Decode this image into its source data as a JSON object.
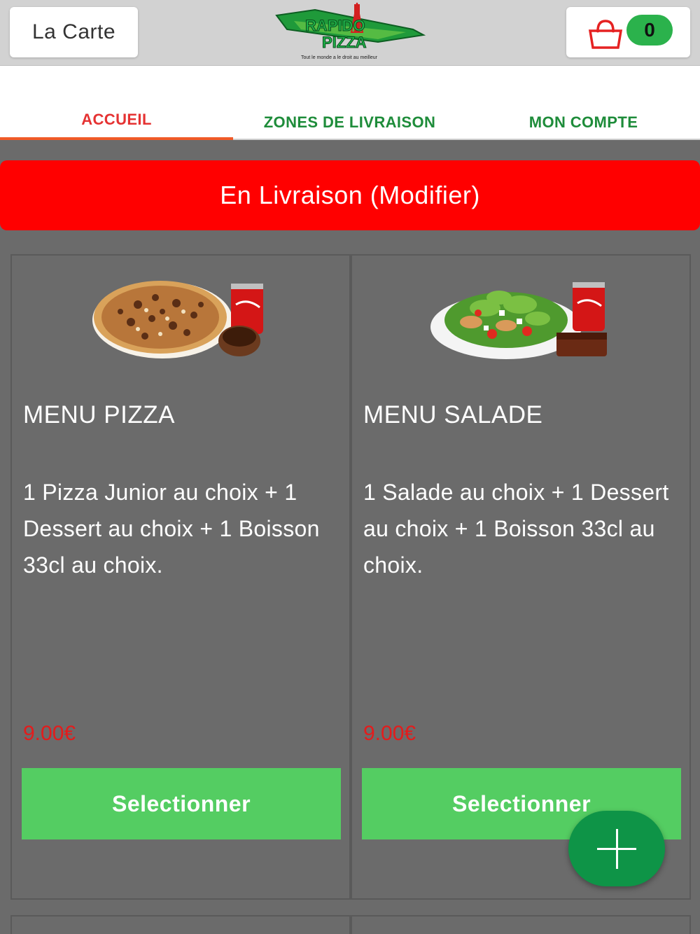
{
  "header": {
    "menu_button_label": "La Carte",
    "logo_text_top": "RAPIDO",
    "logo_text_bottom": "PIZZA",
    "logo_tagline": "Tout le monde a le droit au meilleur",
    "cart_count": "0"
  },
  "tabs": [
    {
      "label": "ACCUEIL",
      "active": true
    },
    {
      "label": "ZONES DE LIVRAISON",
      "active": false
    },
    {
      "label": "MON COMPTE",
      "active": false
    }
  ],
  "delivery_banner": "En Livraison (Modifier)",
  "products": [
    {
      "title": "MENU PIZZA",
      "description": "1 Pizza Junior au choix + 1 Dessert au choix + 1 Boisson 33cl au choix.",
      "price": "9.00€",
      "button": "Selectionner",
      "image": "pizza-menu-image"
    },
    {
      "title": "MENU SALADE",
      "description": "1 Salade au choix + 1 Dessert au choix + 1 Boisson 33cl au choix.",
      "price": "9.00€",
      "button": "Selectionner",
      "image": "salad-menu-image"
    }
  ],
  "colors": {
    "header_bg": "#d2d2d2",
    "active_tab": "#e53232",
    "inactive_tab": "#1e8c3a",
    "banner": "#ff0000",
    "page_bg": "#6b6b6b",
    "price": "#e31c1c",
    "select_button": "#54cd62",
    "fab": "#0e9447",
    "cart_badge": "#2bb24c"
  },
  "fab_icon": "plus-icon",
  "cart_icon": "shopping-bag-icon"
}
